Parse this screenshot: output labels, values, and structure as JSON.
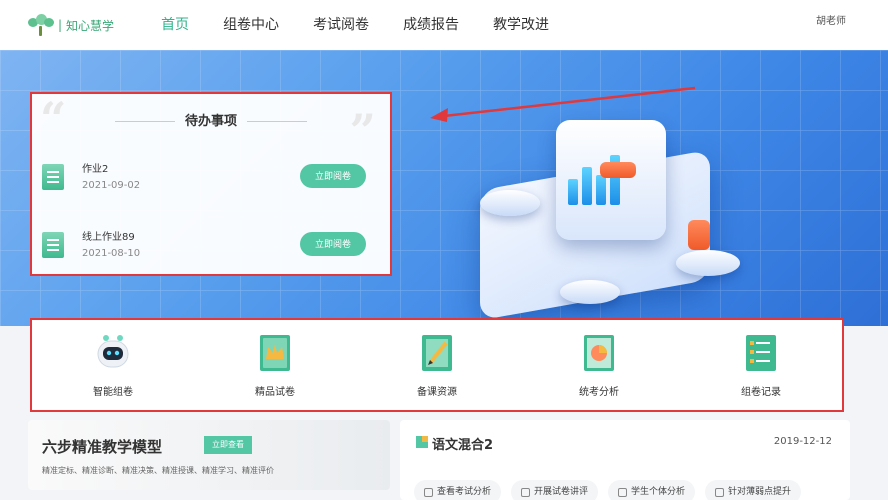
{
  "header": {
    "logo_text": "知心慧学",
    "logo_sep": "|",
    "nav": [
      {
        "label": "首页",
        "active": true
      },
      {
        "label": "组卷中心",
        "active": false
      },
      {
        "label": "考试阅卷",
        "active": false
      },
      {
        "label": "成绩报告",
        "active": false
      },
      {
        "label": "教学改进",
        "active": false
      }
    ],
    "user": "胡老师"
  },
  "todo": {
    "title": "待办事项",
    "items": [
      {
        "name": "作业2",
        "date": "2021-09-02",
        "button": "立即阅卷"
      },
      {
        "name": "线上作业89",
        "date": "2021-08-10",
        "button": "立即阅卷"
      }
    ]
  },
  "tools": [
    {
      "label": "智能组卷",
      "icon": "robot-icon"
    },
    {
      "label": "精品试卷",
      "icon": "crown-icon"
    },
    {
      "label": "备课资源",
      "icon": "notebook-pencil-icon"
    },
    {
      "label": "统考分析",
      "icon": "pie-chart-icon"
    },
    {
      "label": "组卷记录",
      "icon": "list-icon"
    }
  ],
  "model": {
    "title": "六步精准教学模型",
    "button": "立即查看",
    "subtitle": "精准定标、精准诊断、精准决策、精准授课、精准学习、精准评价"
  },
  "exam": {
    "title": "语文混合2",
    "date": "2019-12-12",
    "actions": [
      "查看考试分析",
      "开展试卷讲评",
      "学生个体分析",
      "针对薄弱点提升"
    ]
  },
  "colors": {
    "accent": "#53c6a4",
    "highlight_border": "#e0383b",
    "nav_active": "#2fb38a"
  }
}
